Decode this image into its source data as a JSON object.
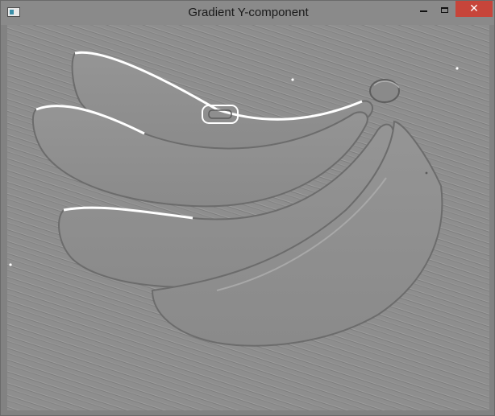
{
  "window": {
    "title": "Gradient Y-component",
    "icons": {
      "app": "app-window-icon",
      "minimize": "minimize-icon",
      "maximize": "maximize-icon",
      "close": "close-icon"
    },
    "close_glyph": "✕",
    "colors": {
      "titlebar": "#8a8a8a",
      "close_button": "#c7453a",
      "image_background": "#8e8e8e"
    }
  },
  "image": {
    "content": "bananas-gradient-y-image"
  }
}
